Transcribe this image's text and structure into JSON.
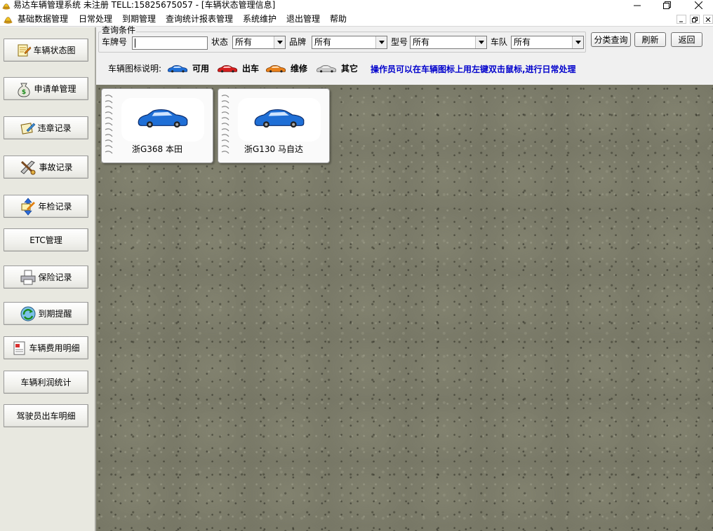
{
  "window": {
    "title": "易达车辆管理系统 未注册 TELL:15825675057 - [车辆状态管理信息]"
  },
  "menu": {
    "items": [
      "基础数据管理",
      "日常处理",
      "到期管理",
      "查询统计报表管理",
      "系统维护",
      "退出管理",
      "帮助"
    ]
  },
  "sidebar": {
    "items": [
      {
        "label": "车辆状态图",
        "icon": "vehicle-status-icon"
      },
      {
        "label": "申请单管理",
        "icon": "money-bag-icon"
      },
      {
        "label": "违章记录",
        "icon": "violation-record-icon"
      },
      {
        "label": "事故记录",
        "icon": "accident-tools-icon"
      },
      {
        "label": "年检记录",
        "icon": "annual-inspection-icon"
      },
      {
        "label": "ETC管理",
        "icon": ""
      },
      {
        "label": "保险记录",
        "icon": "printer-icon"
      },
      {
        "label": "到期提醒",
        "icon": "refresh-globe-icon"
      },
      {
        "label": "车辆费用明细",
        "icon": "expense-detail-icon"
      },
      {
        "label": "车辆利润统计",
        "icon": ""
      },
      {
        "label": "驾驶员出车明细",
        "icon": ""
      }
    ]
  },
  "query": {
    "group_label": "查询条件",
    "plate_label": "车牌号",
    "plate_value": "",
    "status_label": "状态",
    "status_value": "所有",
    "brand_label": "品牌",
    "brand_value": "所有",
    "model_label": "型号",
    "model_value": "所有",
    "team_label": "车队",
    "team_value": "所有",
    "classify_button": "分类查询",
    "refresh_button": "刷新",
    "back_button": "返回"
  },
  "legend": {
    "title": "车辆图标说明:",
    "items": [
      {
        "label": "可用",
        "color": "#1f6fd6"
      },
      {
        "label": "出车",
        "color": "#d41e1e"
      },
      {
        "label": "维修",
        "color": "#e8801a"
      },
      {
        "label": "其它",
        "color": "#c8c8c8"
      }
    ],
    "instruction": "操作员可以在车辆图标上用左键双击鼠标,进行日常处理"
  },
  "vehicles": [
    {
      "plate": "浙G368 本田",
      "status": "可用"
    },
    {
      "plate": "浙G130 马自达",
      "status": "可用"
    }
  ],
  "colors": {
    "instruction_text": "#0000cc",
    "canvas_background": "#7c7c6a"
  }
}
